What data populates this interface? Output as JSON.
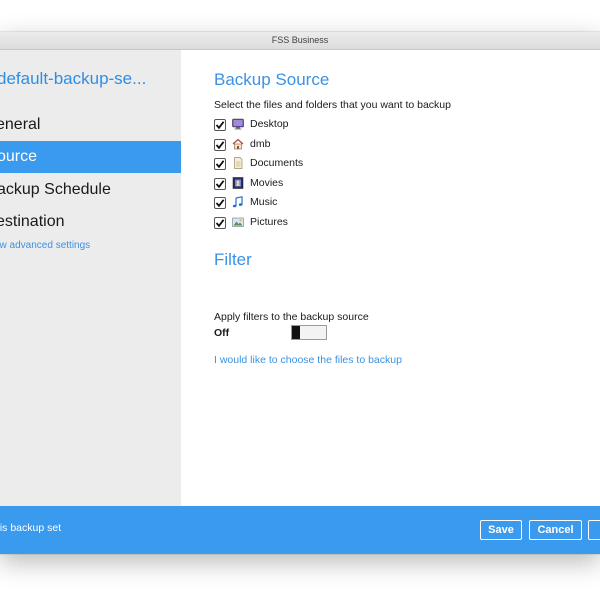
{
  "window": {
    "title": "FSS Business"
  },
  "sidebar": {
    "backup_set_name": "default-backup-se...",
    "items": [
      {
        "label": "eneral"
      },
      {
        "label": "ource",
        "active": true
      },
      {
        "label": "ackup Schedule"
      },
      {
        "label": "estination"
      }
    ],
    "advanced_link": "ow advanced settings"
  },
  "main": {
    "backup_source": {
      "heading": "Backup Source",
      "instruction": "Select the files and folders that you want to backup",
      "items": [
        {
          "label": "Desktop",
          "checked": true,
          "icon": "desktop-icon"
        },
        {
          "label": "dmb",
          "checked": true,
          "icon": "home-icon"
        },
        {
          "label": "Documents",
          "checked": true,
          "icon": "documents-icon"
        },
        {
          "label": "Movies",
          "checked": true,
          "icon": "movies-icon"
        },
        {
          "label": "Music",
          "checked": true,
          "icon": "music-icon"
        },
        {
          "label": "Pictures",
          "checked": true,
          "icon": "pictures-icon"
        }
      ]
    },
    "filter": {
      "heading": "Filter",
      "instruction": "Apply filters to the backup source",
      "state_label": "Off"
    },
    "choose_files_link": "I would like to choose the files to backup"
  },
  "footer": {
    "text": "his backup set",
    "buttons": {
      "save": "Save",
      "cancel": "Cancel"
    }
  },
  "colors": {
    "accent": "#3a9aee",
    "link": "#3b92e4",
    "sidebar_bg": "#ececec"
  }
}
